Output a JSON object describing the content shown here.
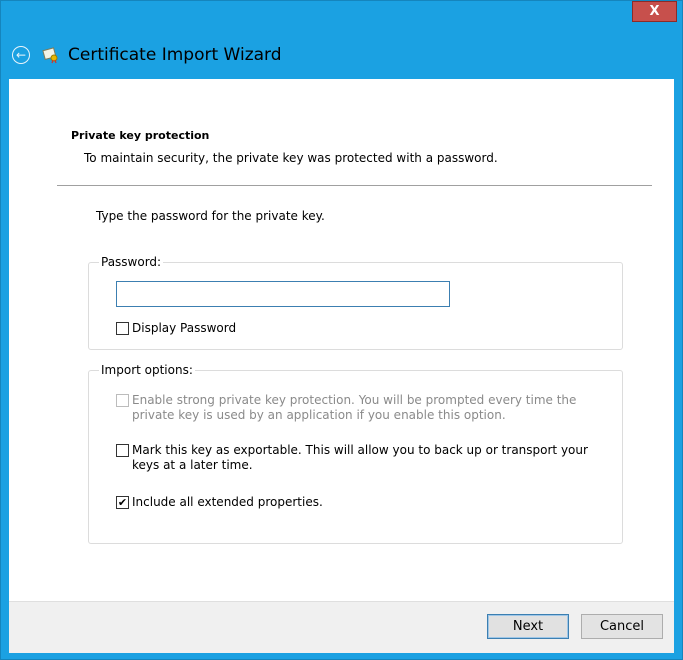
{
  "window": {
    "close_label": "X",
    "title": "Certificate Import Wizard"
  },
  "page": {
    "heading": "Private key protection",
    "description": "To maintain security, the private key was protected with a password.",
    "instruction": "Type the password for the private key."
  },
  "password_group": {
    "label": "Password:",
    "value": "",
    "display_password": {
      "label": "Display Password",
      "checked": false
    }
  },
  "import_options": {
    "label": "Import options:",
    "options": [
      {
        "line1": "Enable strong private key protection. You will be prompted every time the",
        "line2": "private key is used by an application if you enable this option.",
        "checked": false,
        "disabled": true
      },
      {
        "line1": "Mark this key as exportable. This will allow you to back up or transport your",
        "line2": "keys at a later time.",
        "checked": false,
        "disabled": false
      },
      {
        "line1": "Include all extended properties.",
        "checked": true,
        "disabled": false
      }
    ]
  },
  "buttons": {
    "next": "Next",
    "cancel": "Cancel"
  },
  "colors": {
    "title_bar": "#1ba1e2",
    "close_button": "#c7504c"
  }
}
